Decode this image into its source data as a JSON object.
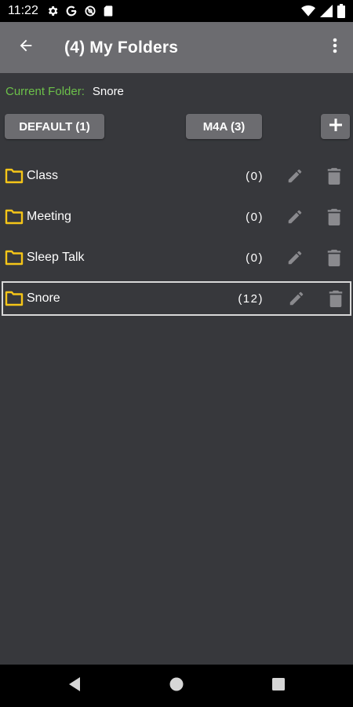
{
  "status_bar": {
    "time": "11:22",
    "icons": [
      "settings-icon",
      "google-icon",
      "data-saver-icon",
      "sd-card-icon",
      "wifi-icon",
      "cell-signal-icon",
      "battery-icon"
    ]
  },
  "app_bar": {
    "title": "(4) My Folders"
  },
  "current_folder": {
    "label": "Current Folder:",
    "value": "Snore"
  },
  "buttons": {
    "default_label": "DEFAULT (1)",
    "m4a_label": "M4A (3)",
    "add_label": "+"
  },
  "folders": [
    {
      "name": "Class",
      "count": "(0)",
      "selected": false
    },
    {
      "name": "Meeting",
      "count": "(0)",
      "selected": false
    },
    {
      "name": "Sleep Talk",
      "count": "(0)",
      "selected": false
    },
    {
      "name": "Snore",
      "count": "(12)",
      "selected": true
    }
  ],
  "colors": {
    "background": "#37383c",
    "app_bar": "#6c6c70",
    "accent_green": "#6cc04a",
    "folder_yellow": "#f5c518",
    "icon_gray": "#8a8a8e"
  }
}
